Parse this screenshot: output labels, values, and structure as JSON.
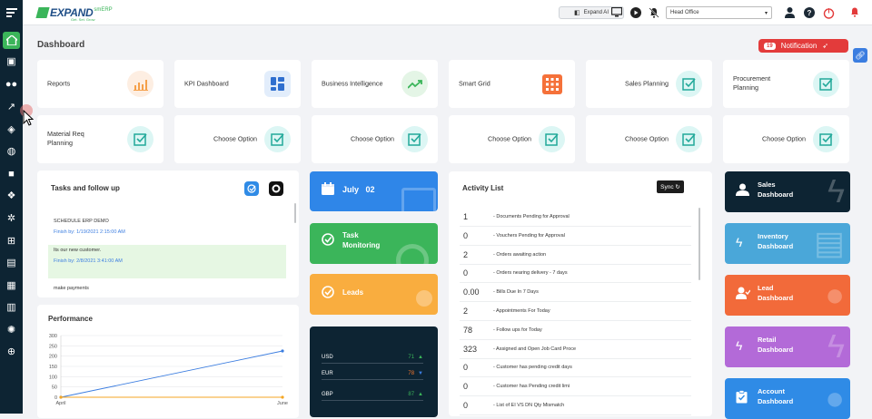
{
  "app": {
    "logo_text": "EXPAND",
    "logo_suffix": "smERP",
    "logo_tagline": "Get. Set. Grow"
  },
  "topbar": {
    "expand_ai_label": "Expand AI",
    "branch_selected": "Head Office"
  },
  "page": {
    "title": "Dashboard"
  },
  "notification": {
    "count": "19",
    "label": "Notification"
  },
  "tiles_row1": [
    {
      "label": "Reports",
      "icon": "bar-chart-icon"
    },
    {
      "label": "KPI Dashboard",
      "icon": "dashboard-icon"
    },
    {
      "label": "Business Intelligence",
      "icon": "trend-icon"
    },
    {
      "label": "Smart Grid",
      "icon": "grid-icon"
    },
    {
      "label": "Sales Planning",
      "icon": "check-square-icon"
    },
    {
      "label": "Procurement Planning",
      "icon": "check-square-icon"
    }
  ],
  "tiles_row2": [
    {
      "label": "Material Req Planning",
      "icon": "check-square-icon"
    },
    {
      "label": "Choose Option",
      "icon": "check-square-icon"
    },
    {
      "label": "Choose Option",
      "icon": "check-square-icon"
    },
    {
      "label": "Choose Option",
      "icon": "check-square-icon"
    },
    {
      "label": "Choose Option",
      "icon": "check-square-icon"
    },
    {
      "label": "Choose Option",
      "icon": "check-square-icon"
    }
  ],
  "tasks": {
    "title": "Tasks and follow up",
    "items": [
      {
        "text": "SCHEDULE ERP DEMO",
        "finish": "Finish by: 1/19/2021 2:15:00 AM"
      },
      {
        "text": "Its our new customer.",
        "finish": "Finish by: 2/8/2021 3:41:00 AM"
      },
      {
        "text": "make payments",
        "finish": ""
      }
    ]
  },
  "performance": {
    "title": "Performance"
  },
  "chart_data": {
    "type": "line",
    "title": "Performance",
    "x": [
      "April",
      "June"
    ],
    "ylim": [
      0,
      300
    ],
    "yticks": [
      0,
      50,
      100,
      150,
      200,
      250,
      300
    ],
    "series": [
      {
        "values": [
          0,
          225
        ],
        "color": "#3b7de0"
      },
      {
        "values": [
          0,
          0
        ],
        "color": "#f5a623"
      }
    ]
  },
  "mid_cards": {
    "date_month": "July",
    "date_day": "02",
    "task_monitoring": "Task Monitoring",
    "leads": "Leads"
  },
  "fx": [
    {
      "code": "USD",
      "value": "71",
      "dir": "up",
      "color": "#3bb55a"
    },
    {
      "code": "EUR",
      "value": "78",
      "dir": "down",
      "color": "#f5772d"
    },
    {
      "code": "GBP",
      "value": "87",
      "dir": "up",
      "color": "#3bb55a"
    }
  ],
  "activity": {
    "title": "Activity List",
    "sync_label": "Sync",
    "rows": [
      {
        "n": "1",
        "label": "- Documents Pending for Approval"
      },
      {
        "n": "0",
        "label": "- Vouchers Pending for Approval"
      },
      {
        "n": "2",
        "label": "- Orders awaiting action"
      },
      {
        "n": "0",
        "label": "- Orders nearing delivery - 7 days"
      },
      {
        "n": "0.00",
        "label": "- Bills Due In 7 Days"
      },
      {
        "n": "2",
        "label": "- Appointments For Today"
      },
      {
        "n": "78",
        "label": "- Follow ups for Today"
      },
      {
        "n": "323",
        "label": "- Assigned and Open Job Card Proce"
      },
      {
        "n": "0",
        "label": "- Customer has pending credit days"
      },
      {
        "n": "0",
        "label": "- Customer has Pending credit limi"
      },
      {
        "n": "0",
        "label": "- List of EI VS DN Qty Mismatch"
      }
    ]
  },
  "dashboards": [
    {
      "label": "Sales Dashboard",
      "color": "#0d2433"
    },
    {
      "label": "Inventory Dashboard",
      "color": "#4aa7d9"
    },
    {
      "label": "Lead Dashboard",
      "color": "#f26a3a"
    },
    {
      "label": "Retail Dashboard",
      "color": "#b36ad8"
    },
    {
      "label": "Account Dashboard",
      "color": "#2f8be6"
    }
  ]
}
